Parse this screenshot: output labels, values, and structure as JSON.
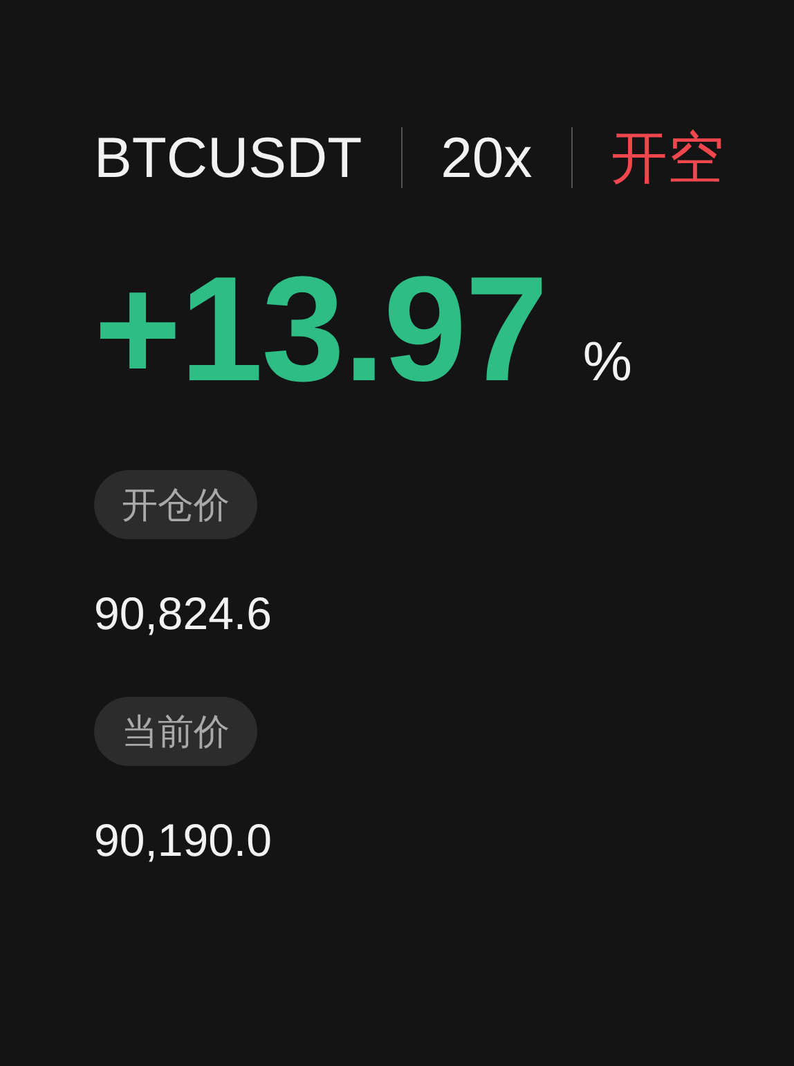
{
  "header": {
    "symbol": "BTCUSDT",
    "leverage": "20x",
    "side": {
      "label": "开空",
      "kind": "short"
    }
  },
  "pnl": {
    "value": "+13.97",
    "unit": "%",
    "kind": "profit"
  },
  "prices": [
    {
      "label": "开仓价",
      "value": "90,824.6"
    },
    {
      "label": "当前价",
      "value": "90,190.0"
    }
  ]
}
